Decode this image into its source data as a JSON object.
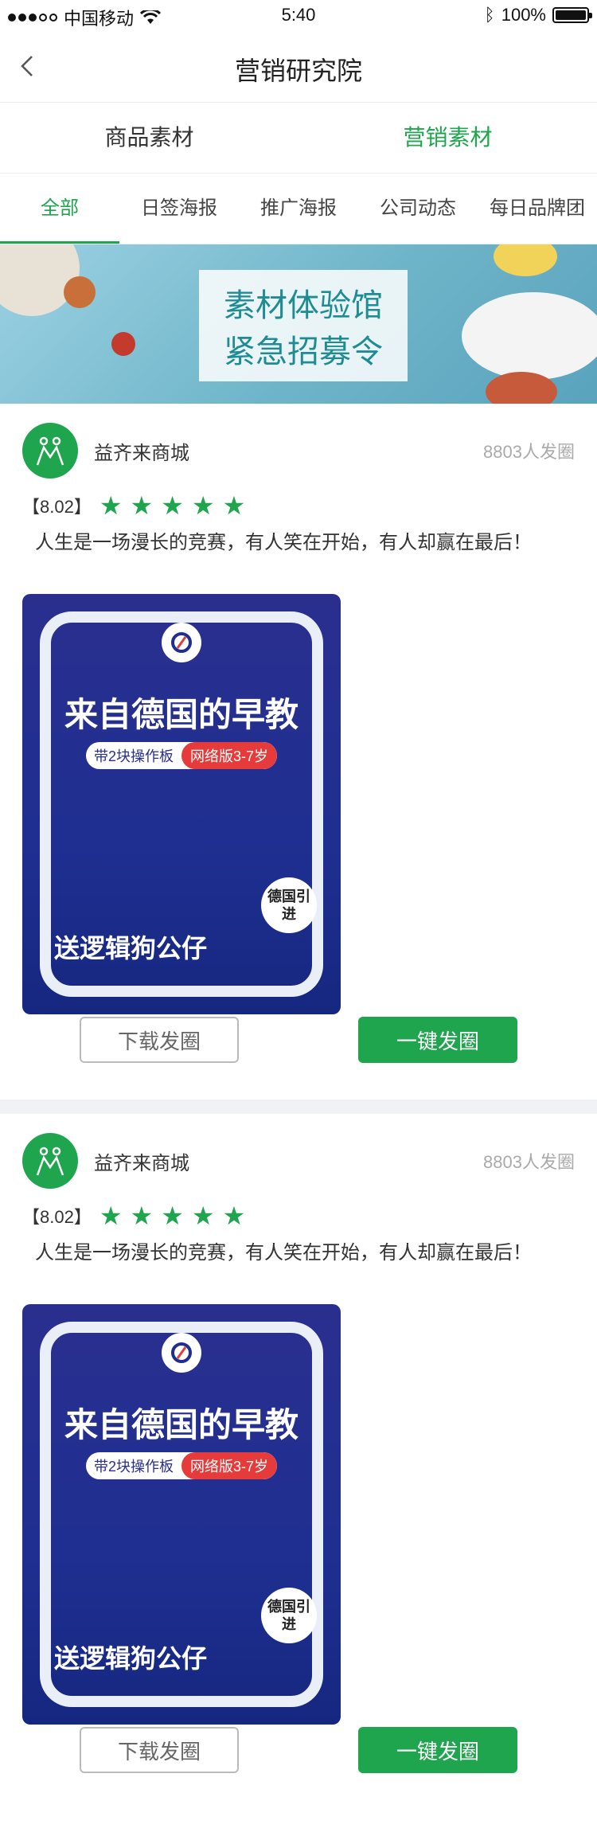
{
  "status_bar": {
    "carrier": "中国移动",
    "time": "5:40",
    "battery": "100%"
  },
  "nav": {
    "title": "营销研究院"
  },
  "main_tabs": [
    {
      "label": "商品素材"
    },
    {
      "label": "营销素材"
    }
  ],
  "sub_tabs": [
    {
      "label": "全部"
    },
    {
      "label": "日签海报"
    },
    {
      "label": "推广海报"
    },
    {
      "label": "公司动态"
    },
    {
      "label": "每日品牌团"
    }
  ],
  "banner": {
    "line1": "素材体验馆",
    "line2": "紧急招募令"
  },
  "posts": [
    {
      "seller": "益齐来商城",
      "count": "8803人发圈",
      "score": "【8.02】",
      "stars": 5,
      "desc": "人生是一场漫长的竞赛，有人笑在开始，有人却赢在最后！",
      "poster": {
        "title": "来自德国的早教",
        "tag_left": "带2块操作板",
        "tag_right": "网络版3-7岁",
        "bottom": "送逻辑狗公仔",
        "badge": "德国引进"
      },
      "download_label": "下载发圈",
      "share_label": "一键发圈"
    },
    {
      "seller": "益齐来商城",
      "count": "8803人发圈",
      "score": "【8.02】",
      "stars": 5,
      "desc": "人生是一场漫长的竞赛，有人笑在开始，有人却赢在最后！",
      "poster": {
        "title": "来自德国的早教",
        "tag_left": "带2块操作板",
        "tag_right": "网络版3-7岁",
        "bottom": "送逻辑狗公仔",
        "badge": "德国引进"
      },
      "download_label": "下载发圈",
      "share_label": "一键发圈"
    }
  ],
  "colors": {
    "accent": "#1ea54d",
    "poster_bg": "#1e2f91"
  }
}
